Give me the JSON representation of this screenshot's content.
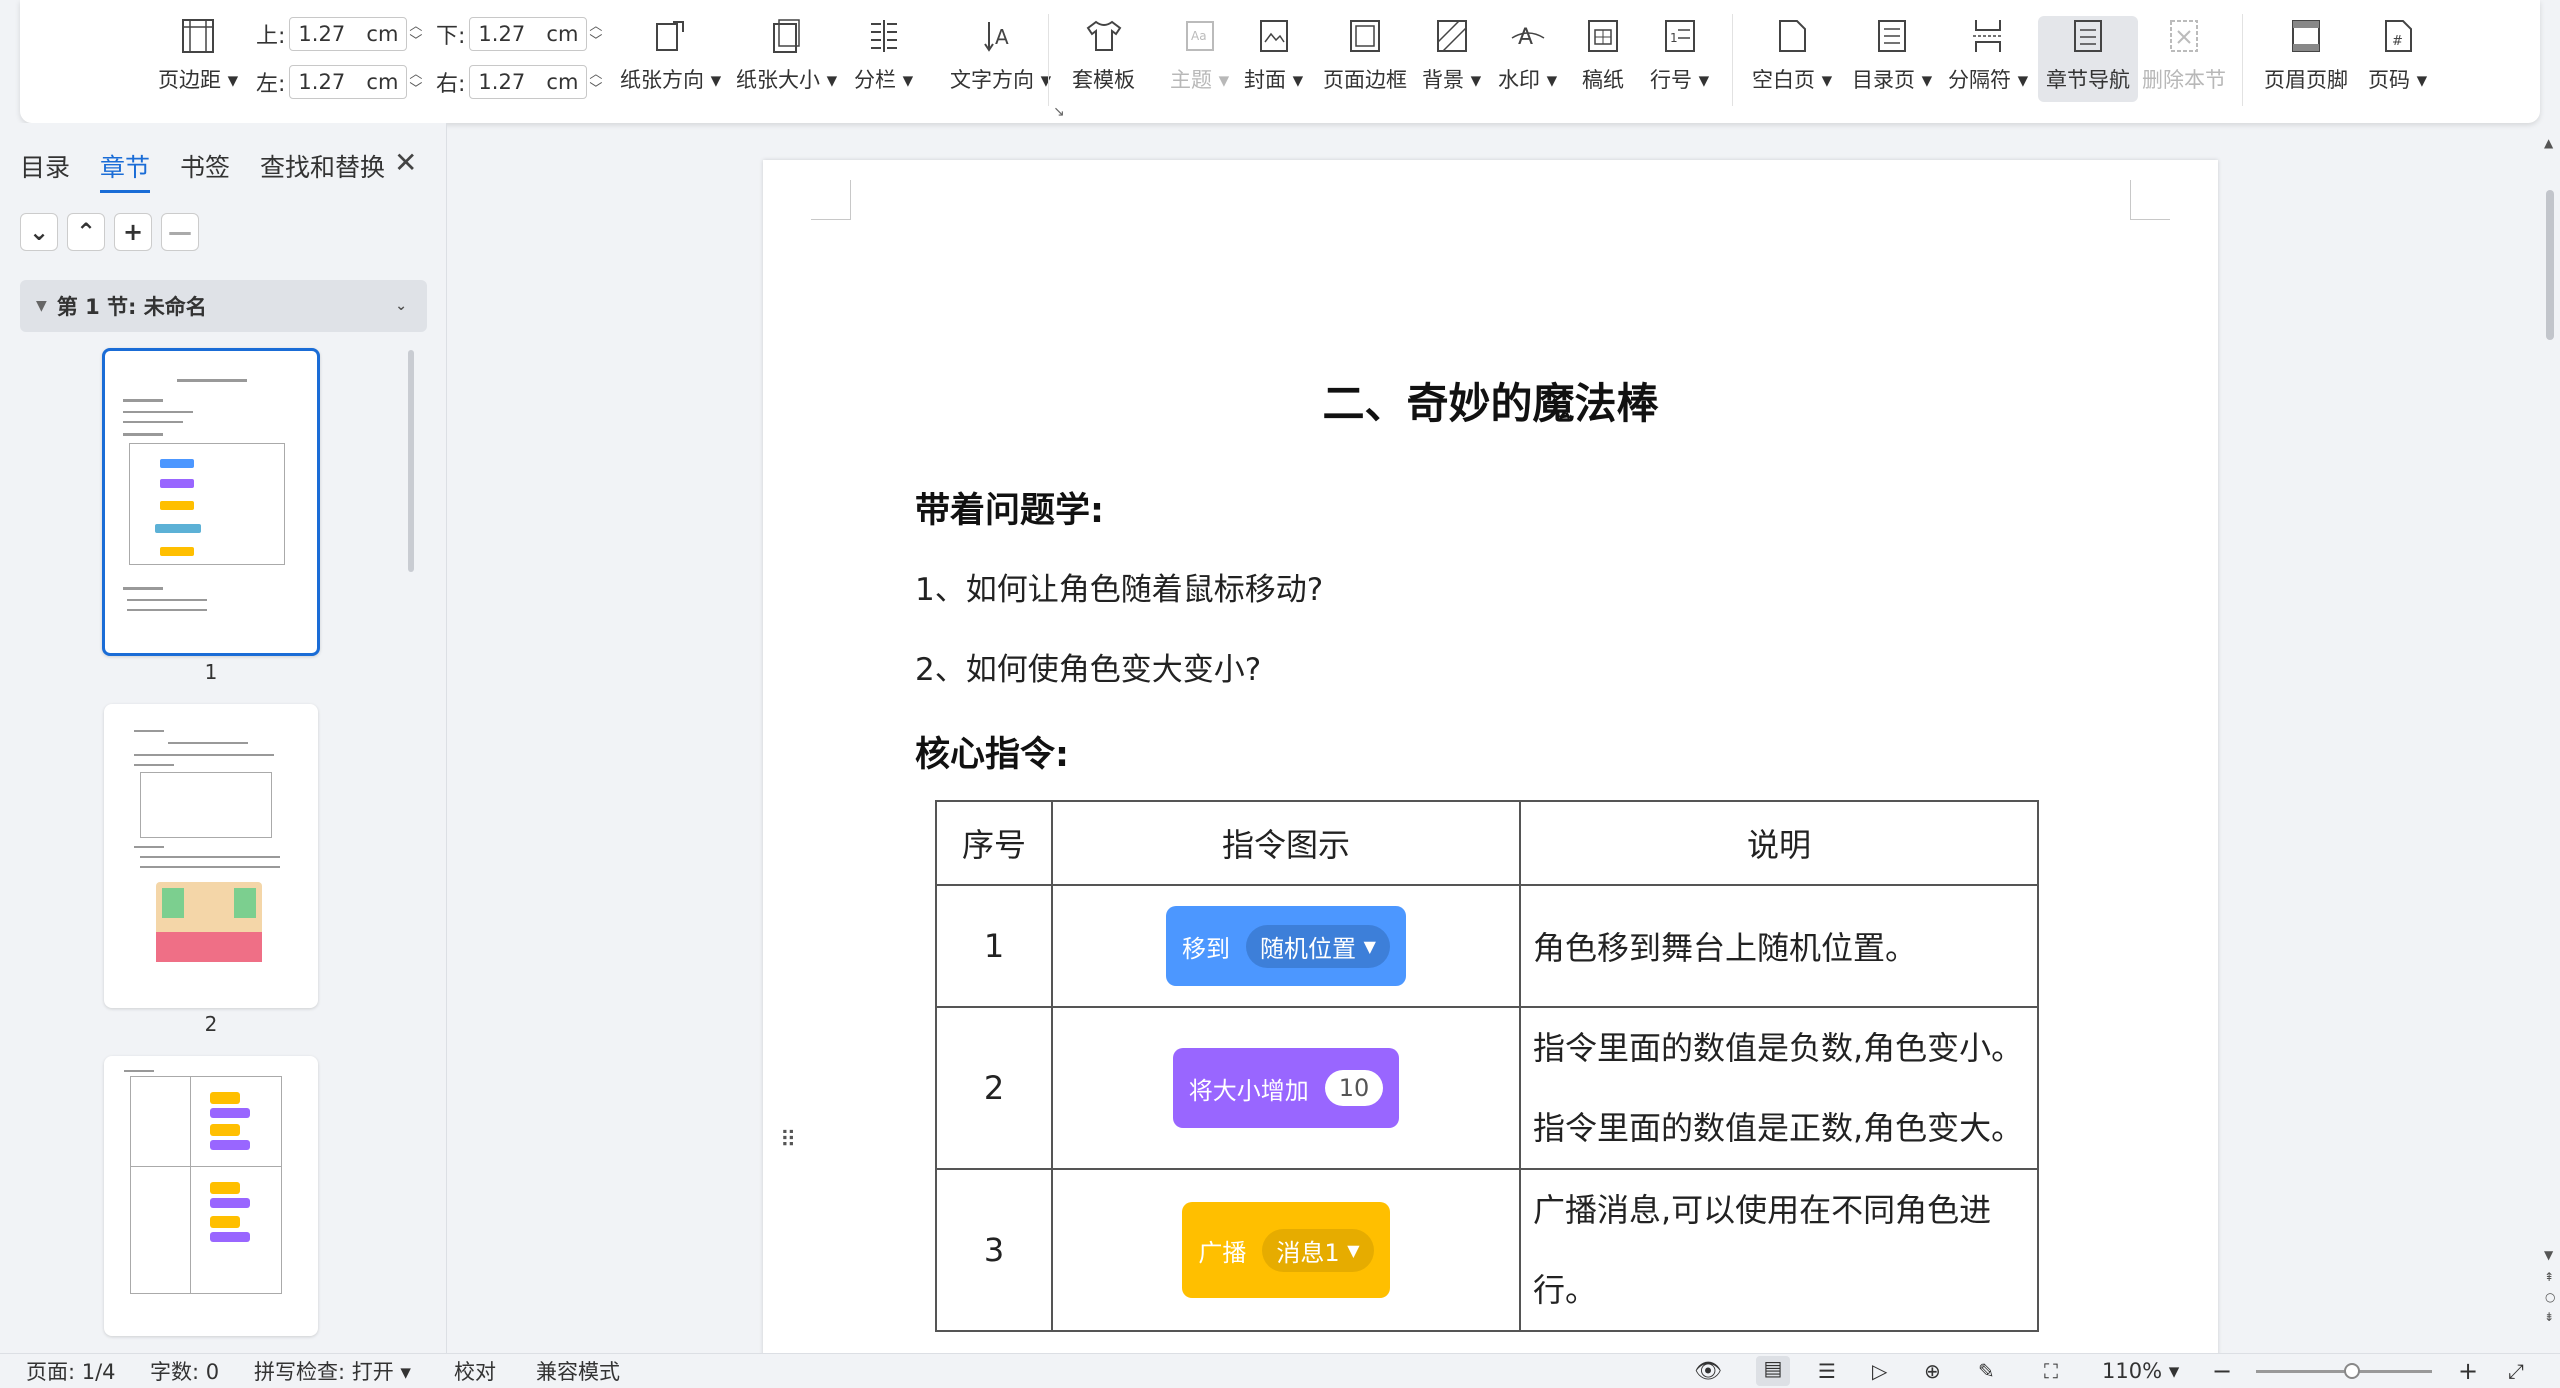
{
  "ribbon": {
    "margins_label": "页边距",
    "top_label": "上:",
    "top_value": "1.27",
    "bottom_label": "下:",
    "bottom_value": "1.27",
    "left_label": "左:",
    "left_value": "1.27",
    "right_label": "右:",
    "right_value": "1.27",
    "unit": "cm",
    "orientation": "纸张方向",
    "size": "纸张大小",
    "columns": "分栏",
    "text_direction": "文字方向",
    "template": "套模板",
    "theme": "主题",
    "cover": "封面",
    "page_border": "页面边框",
    "background": "背景",
    "watermark": "水印",
    "manuscript": "稿纸",
    "line_number": "行号",
    "blank_page": "空白页",
    "toc_page": "目录页",
    "separator": "分隔符",
    "section_nav": "章节导航",
    "delete_section": "删除本节",
    "header_footer": "页眉页脚",
    "page_number": "页码"
  },
  "pane": {
    "tabs": [
      "目录",
      "章节",
      "书签",
      "查找和替换"
    ],
    "section": "第 1 节: 未命名",
    "pages": [
      "1",
      "2"
    ]
  },
  "doc": {
    "title": "二、奇妙的魔法棒",
    "h1": "带着问题学:",
    "q1": "1、如何让角色随着鼠标移动?",
    "q2": "2、如何使角色变大变小?",
    "h2": "核心指令:",
    "table": {
      "headers": [
        "序号",
        "指令图示",
        "说明"
      ],
      "rows": [
        {
          "no": "1",
          "block": "移到",
          "pill": "随机位置",
          "desc": "角色移到舞台上随机位置。"
        },
        {
          "no": "2",
          "block": "将大小增加",
          "pill": "10",
          "desc": "指令里面的数值是负数,角色变小。",
          "desc2": "指令里面的数值是正数,角色变大。"
        },
        {
          "no": "3",
          "block": "广播",
          "pill": "消息1",
          "desc": "广播消息,可以使用在不同角色进",
          "desc2": "行。"
        }
      ]
    }
  },
  "status": {
    "page": "页面: 1/4",
    "words": "字数: 0",
    "spell": "拼写检查: 打开",
    "proof": "校对",
    "compat": "兼容模式",
    "zoom": "110%"
  },
  "colors": {
    "accent": "#1a6cd6",
    "motion": "#4c97ff",
    "looks": "#9966ff",
    "events": "#ffbf00"
  }
}
